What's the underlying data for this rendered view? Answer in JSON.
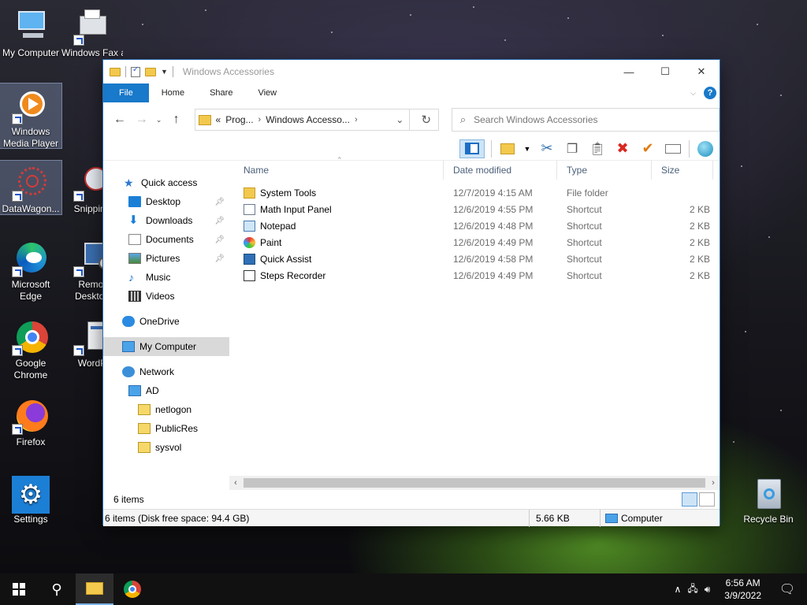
{
  "desktop": {
    "icons": [
      {
        "label": "My Computer",
        "icon": "computer-icon"
      },
      {
        "label": "Windows Fax and Sc",
        "icon": "fax-icon"
      },
      {
        "label": "Windows Media Player",
        "icon": "media-player-icon"
      },
      {
        "label": "DataWagon...",
        "icon": "datawagon-icon"
      },
      {
        "label": "Snipping",
        "icon": "snipping-tool-icon"
      },
      {
        "label": "Microsoft Edge",
        "icon": "edge-icon"
      },
      {
        "label": "Remot Desktop",
        "icon": "remote-desktop-icon"
      },
      {
        "label": "Google Chrome",
        "icon": "chrome-icon"
      },
      {
        "label": "WordP",
        "icon": "wordpad-icon"
      },
      {
        "label": "Firefox",
        "icon": "firefox-icon"
      },
      {
        "label": "Settings",
        "icon": "settings-icon"
      },
      {
        "label": "Recycle Bin",
        "icon": "recycle-bin-icon"
      }
    ]
  },
  "window": {
    "title": "Windows Accessories",
    "controls": {
      "minimize": "—",
      "maximize": "☐",
      "close": "✕"
    },
    "ribbon_tabs": [
      "File",
      "Home",
      "Share",
      "View"
    ],
    "help": "?",
    "address": {
      "overflow": "«",
      "crumbs": [
        "Prog...",
        "Windows Accesso..."
      ]
    },
    "search_placeholder": "Search Windows Accessories",
    "nav": {
      "quick_access": "Quick access",
      "quick_items": [
        "Desktop",
        "Downloads",
        "Documents",
        "Pictures",
        "Music",
        "Videos"
      ],
      "onedrive": "OneDrive",
      "my_computer": "My Computer",
      "network": "Network",
      "ad": "AD",
      "shares": [
        "netlogon",
        "PublicRes",
        "sysvol"
      ]
    },
    "columns": [
      "Name",
      "Date modified",
      "Type",
      "Size"
    ],
    "files": [
      {
        "name": "System Tools",
        "date": "12/7/2019 4:15 AM",
        "type": "File folder",
        "size": "",
        "icon": "folder-icon"
      },
      {
        "name": "Math Input Panel",
        "date": "12/6/2019 4:55 PM",
        "type": "Shortcut",
        "size": "2 KB",
        "icon": "math-input-icon"
      },
      {
        "name": "Notepad",
        "date": "12/6/2019 4:48 PM",
        "type": "Shortcut",
        "size": "2 KB",
        "icon": "notepad-icon"
      },
      {
        "name": "Paint",
        "date": "12/6/2019 4:49 PM",
        "type": "Shortcut",
        "size": "2 KB",
        "icon": "paint-icon"
      },
      {
        "name": "Quick Assist",
        "date": "12/6/2019 4:58 PM",
        "type": "Shortcut",
        "size": "2 KB",
        "icon": "quick-assist-icon"
      },
      {
        "name": "Steps Recorder",
        "date": "12/6/2019 4:49 PM",
        "type": "Shortcut",
        "size": "2 KB",
        "icon": "steps-recorder-icon"
      }
    ],
    "status": "6 items",
    "details": {
      "summary": "6 items (Disk free space: 94.4 GB)",
      "size": "5.66 KB",
      "location": "Computer"
    }
  },
  "taskbar": {
    "time": "6:56 AM",
    "date": "3/9/2022"
  }
}
